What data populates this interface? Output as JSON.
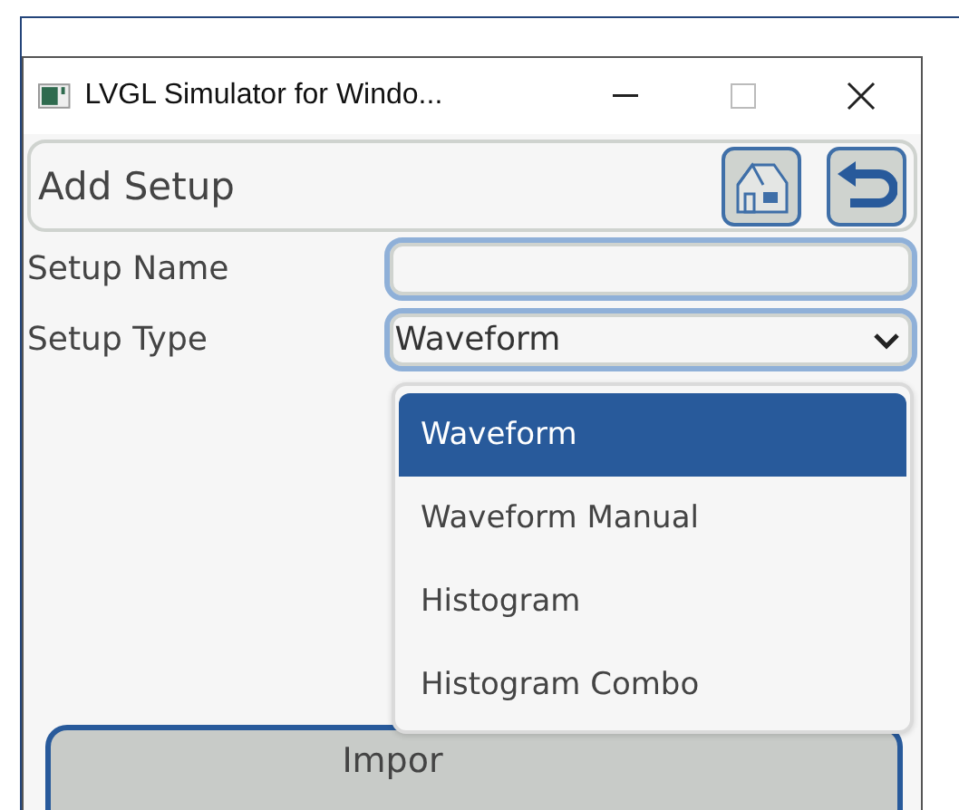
{
  "window": {
    "title": "LVGL Simulator for Windo..."
  },
  "header": {
    "title": "Add Setup"
  },
  "form": {
    "fields": [
      {
        "label": "Setup Name",
        "kind": "text"
      },
      {
        "label": "Setup Type",
        "kind": "select",
        "value": "Waveform"
      }
    ]
  },
  "dropdown": {
    "options": [
      {
        "label": "Waveform",
        "selected": true
      },
      {
        "label": "Waveform Manual",
        "selected": false
      },
      {
        "label": "Histogram",
        "selected": false
      },
      {
        "label": "Histogram Combo",
        "selected": false
      }
    ]
  },
  "button": {
    "label": "Impor"
  }
}
